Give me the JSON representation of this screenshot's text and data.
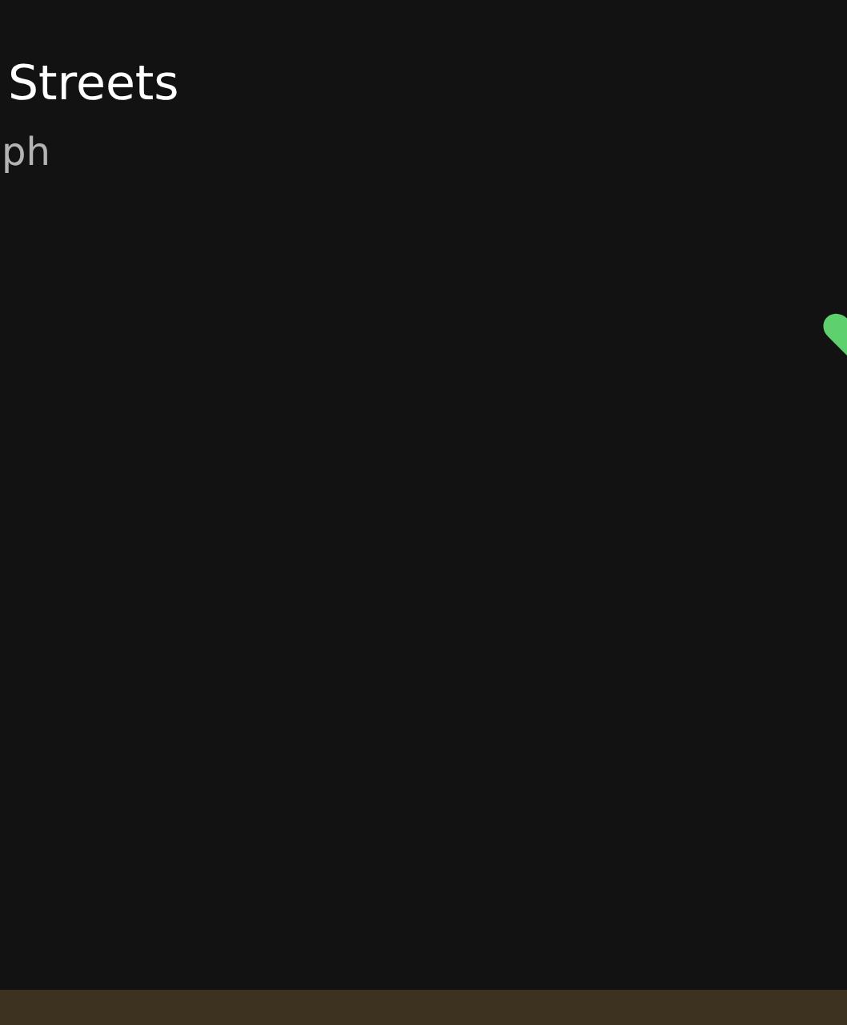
{
  "track": {
    "title": "Streets",
    "artist": "ph",
    "liked": true
  },
  "player_bar": {
    "kind": "mini"
  }
}
